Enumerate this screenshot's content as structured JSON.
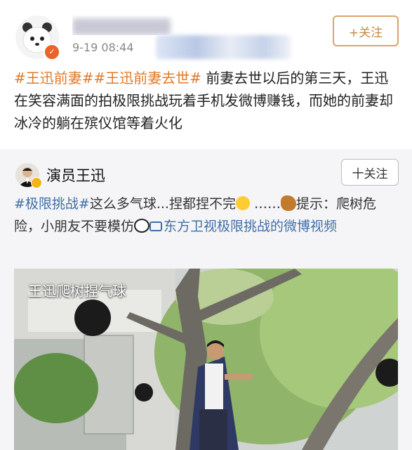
{
  "post": {
    "timestamp": "9-19 08:44",
    "follow_label": "+关注",
    "text": {
      "tag1": "#王迅前妻#",
      "tag2": "#王迅前妻去世#",
      "body": " 前妻去世以后的第三天，王迅在笑容满面的拍极限挑战玩着手机发微博赚钱，而她的前妻却冰冷的躺在殡仪馆等着火化"
    }
  },
  "repost": {
    "author": "演员王迅",
    "follow_label": "十关注",
    "tag": "#极限挑战#",
    "text1": "这么多气球...捏都捏不完",
    "text2": " ……",
    "text3": "提示：爬树危险，小朋友不要模仿",
    "link": "东方卫视极限挑战的微博视频",
    "video_caption": "王迅爬树捏气球"
  },
  "icons": {
    "avatar": "panda-avatar-icon",
    "badge": "verified-badge-icon",
    "laugh": "laughing-emoji-icon",
    "squirrel": "squirrel-emoji-icon",
    "panda": "panda-emoji-icon",
    "video": "video-link-icon"
  },
  "colors": {
    "tag_orange": "#e07a2a",
    "link_blue": "#3f6ea6",
    "follow_border": "#d9a46a"
  }
}
